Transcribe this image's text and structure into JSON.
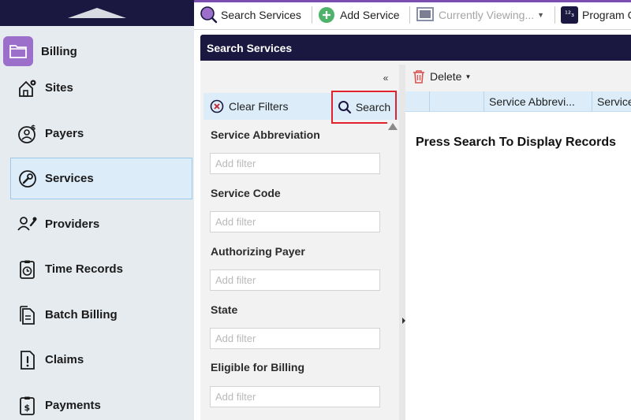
{
  "sidebar": {
    "module_title": "Billing",
    "items": [
      {
        "label": "Sites",
        "icon": "sites-icon"
      },
      {
        "label": "Payers",
        "icon": "payers-icon"
      },
      {
        "label": "Services",
        "icon": "services-icon",
        "active": true
      },
      {
        "label": "Providers",
        "icon": "providers-icon"
      },
      {
        "label": "Time Records",
        "icon": "time-records-icon"
      },
      {
        "label": "Batch Billing",
        "icon": "batch-billing-icon"
      },
      {
        "label": "Claims",
        "icon": "claims-icon"
      },
      {
        "label": "Payments",
        "icon": "payments-icon"
      }
    ]
  },
  "toolbar": {
    "search_services": "Search Services",
    "add_service": "Add Service",
    "currently_viewing": "Currently Viewing...",
    "program": "Program C"
  },
  "panel": {
    "title": "Search Services",
    "clear_filters": "Clear Filters",
    "search": "Search",
    "filters": [
      {
        "label": "Service Abbreviation",
        "placeholder": "Add filter"
      },
      {
        "label": "Service Code",
        "placeholder": "Add filter"
      },
      {
        "label": "Authorizing Payer",
        "placeholder": "Add filter"
      },
      {
        "label": "State",
        "placeholder": "Add filter"
      },
      {
        "label": "Eligible for Billing",
        "placeholder": "Add filter"
      }
    ]
  },
  "results": {
    "delete": "Delete",
    "columns": [
      "Service Abbrevi...",
      "Service"
    ],
    "empty_message": "Press Search To Display Records"
  },
  "colors": {
    "header_navy": "#1a1740",
    "accent_purple": "#9c6fca",
    "active_blue": "#dcecf8",
    "highlight_red": "#e0212e",
    "add_green": "#4db36b"
  }
}
